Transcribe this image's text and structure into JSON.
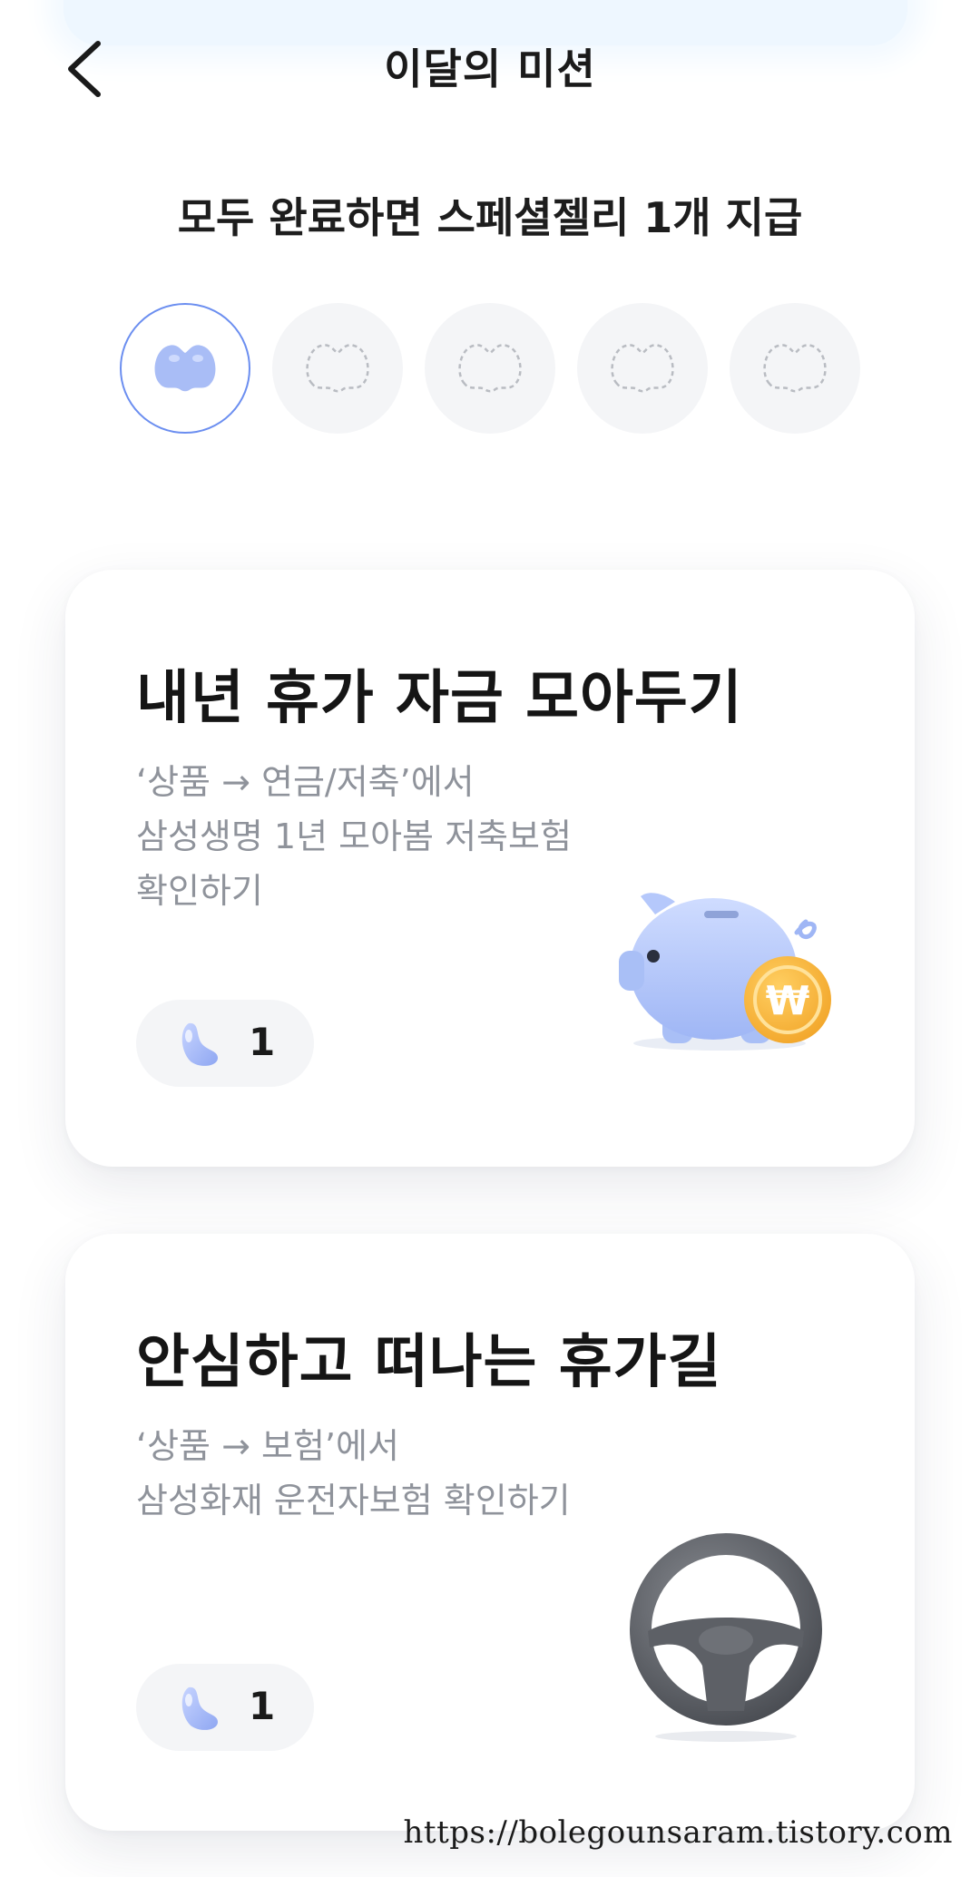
{
  "header": {
    "title": "이달의 미션",
    "back_icon": "chevron-left-icon"
  },
  "subtitle": "모두 완료하면 스페셜젤리 1개 지급",
  "jelly_slots": {
    "total": 5,
    "collected": 1,
    "colors": {
      "active_border": "#6b8ef0",
      "jelly": "#a9bdf6",
      "empty_bg": "#f4f5f7",
      "empty_outline": "#b9bcc2"
    }
  },
  "missions": [
    {
      "title": "내년 휴가 자금 모아두기",
      "description": [
        "‘상품 → 연금/저축’에서",
        "삼성생명 1년 모아봄 저축보험",
        "확인하기"
      ],
      "reward_count": "1",
      "illustration": "piggy-bank-coin-icon"
    },
    {
      "title": "안심하고 떠나는 휴가길",
      "description": [
        "‘상품 → 보험’에서",
        "삼성화재 운전자보험 확인하기"
      ],
      "reward_count": "1",
      "illustration": "steering-wheel-icon"
    }
  ],
  "watermark": "https://bolegounsaram.tistory.com"
}
